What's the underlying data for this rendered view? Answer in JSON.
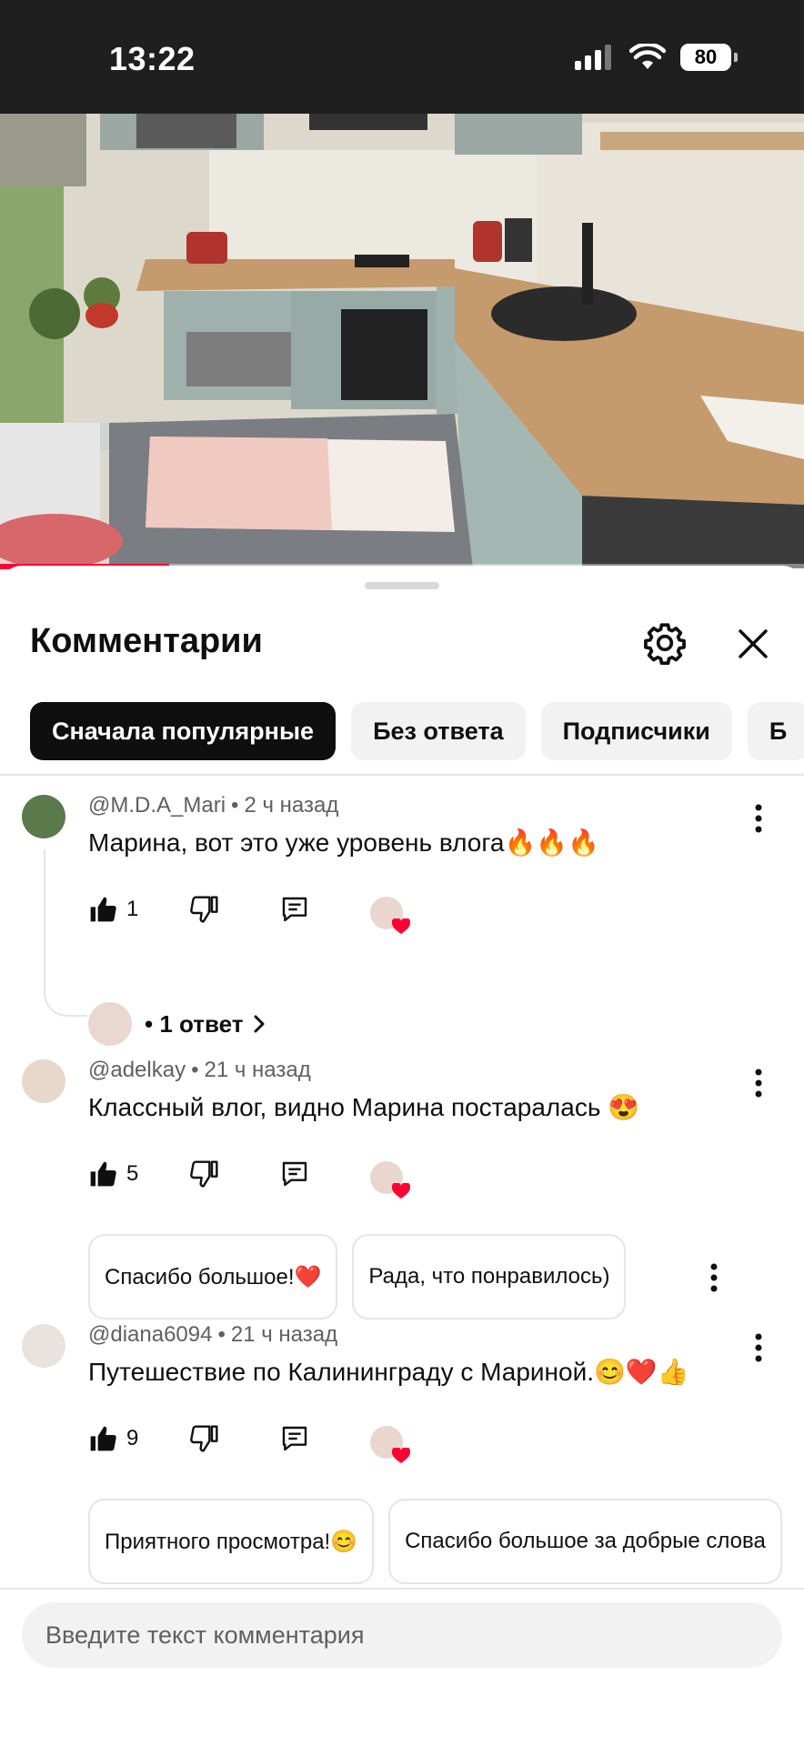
{
  "status_bar": {
    "time": "13:22",
    "battery": "80"
  },
  "video": {
    "progress_fraction": 0.21
  },
  "sheet": {
    "title": "Комментарии",
    "chips": [
      {
        "label": "Сначала популярные",
        "active": true
      },
      {
        "label": "Без ответа",
        "active": false
      },
      {
        "label": "Подписчики",
        "active": false
      },
      {
        "label": "Б",
        "active": false
      }
    ]
  },
  "comments": [
    {
      "author": "@M.D.A_Mari",
      "time": "2 ч назад",
      "text": "Марина, вот это уже уровень влога🔥🔥🔥",
      "likes": "1",
      "replies": "• 1 ответ",
      "suggestions": []
    },
    {
      "author": "@adelkay",
      "time": "21 ч назад",
      "text": "Классный влог, видно Марина постаралась 😍",
      "likes": "5",
      "replies": "",
      "suggestions": [
        "Спасибо большое!❤️",
        "Рада, что понравилось)"
      ]
    },
    {
      "author": "@diana6094",
      "time": "21 ч назад",
      "text": "Путешествие по Калининграду с Мариной.😊❤️👍",
      "likes": "9",
      "replies": "",
      "suggestions": [
        "Приятного просмотра!😊",
        "Спасибо большое за добрые слова"
      ]
    }
  ],
  "input": {
    "placeholder": "Введите текст комментария"
  },
  "colors": {
    "accent": "#ff0033",
    "chip_active": "#0f0f0f",
    "chip": "#f2f2f2"
  }
}
